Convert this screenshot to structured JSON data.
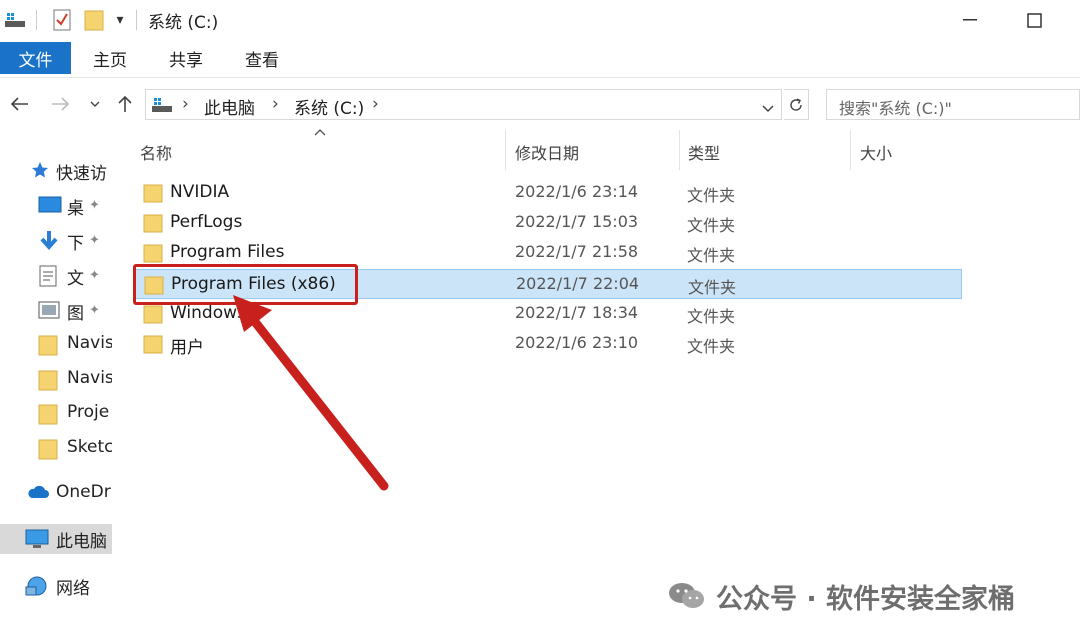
{
  "titlebar": {
    "title": "系统 (C:)"
  },
  "ribbon": {
    "tabs": [
      {
        "label": "文件"
      },
      {
        "label": "主页"
      },
      {
        "label": "共享"
      },
      {
        "label": "查看"
      }
    ]
  },
  "address": {
    "crumbs": [
      "此电脑",
      "系统 (C:)"
    ],
    "search_placeholder": "搜索\"系统 (C:)\""
  },
  "navpane": {
    "quick_access": "快速访",
    "pinned": [
      "桌",
      "下",
      "文",
      "图"
    ],
    "folders": [
      "Navis",
      "Navis",
      "Proje",
      "Sketc"
    ],
    "onedrive": "OneDr",
    "this_pc": "此电脑",
    "network": "网络"
  },
  "columns": {
    "name": "名称",
    "date": "修改日期",
    "type": "类型",
    "size": "大小"
  },
  "files": [
    {
      "name": "NVIDIA",
      "date": "2022/1/6 23:14",
      "type": "文件夹"
    },
    {
      "name": "PerfLogs",
      "date": "2022/1/7 15:03",
      "type": "文件夹"
    },
    {
      "name": "Program Files",
      "date": "2022/1/7 21:58",
      "type": "文件夹"
    },
    {
      "name": "Program Files (x86)",
      "date": "2022/1/7 22:04",
      "type": "文件夹",
      "selected": true
    },
    {
      "name": "Windows",
      "date": "2022/1/7 18:34",
      "type": "文件夹"
    },
    {
      "name": "用户",
      "date": "2022/1/6 23:10",
      "type": "文件夹"
    }
  ],
  "watermark": {
    "text": "公众号 · 软件安装全家桶"
  },
  "colors": {
    "accent": "#1a73c8",
    "selection": "#cce4f7",
    "highlight_annotation": "#c8211d",
    "folder": "#f5d36e"
  }
}
